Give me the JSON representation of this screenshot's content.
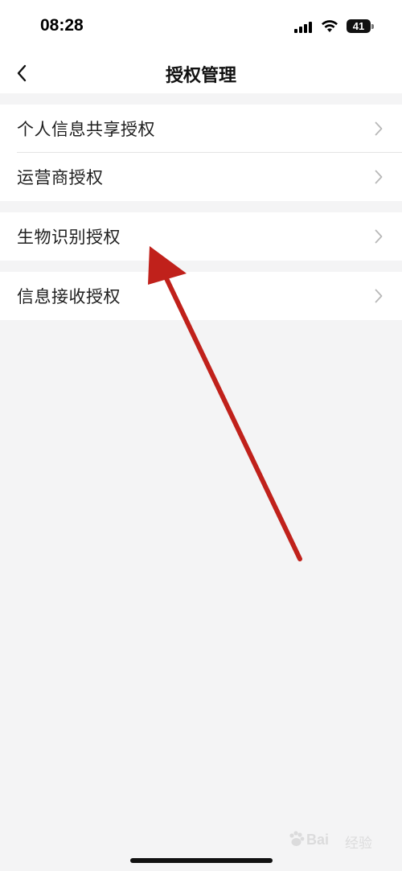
{
  "status_bar": {
    "time": "08:28",
    "battery_level": "41",
    "icons": [
      "signal-icon",
      "wifi-icon",
      "battery-icon"
    ]
  },
  "nav": {
    "back_icon": "chevron-left-icon",
    "title": "授权管理"
  },
  "menu_groups": [
    {
      "items": [
        {
          "label": "个人信息共享授权",
          "icon": "chevron-right-icon"
        },
        {
          "label": "运营商授权",
          "icon": "chevron-right-icon"
        }
      ]
    },
    {
      "items": [
        {
          "label": "生物识别授权",
          "icon": "chevron-right-icon"
        }
      ]
    },
    {
      "items": [
        {
          "label": "信息接收授权",
          "icon": "chevron-right-icon"
        }
      ]
    }
  ],
  "annotation": {
    "type": "arrow",
    "color": "#c0211b",
    "points_to": "生物识别授权"
  },
  "watermark": {
    "text": "Bai",
    "sub": "经验"
  },
  "colors": {
    "background": "#f4f4f5",
    "card": "#ffffff",
    "chevron": "#b8b8b8",
    "arrow": "#c0211b"
  }
}
